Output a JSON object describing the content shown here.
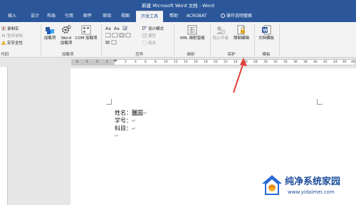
{
  "window": {
    "title": "新建 Microsoft Word 文档 - Word"
  },
  "tabs": [
    {
      "label": "插入"
    },
    {
      "label": "设计"
    },
    {
      "label": "布局"
    },
    {
      "label": "引用"
    },
    {
      "label": "邮件"
    },
    {
      "label": "审阅"
    },
    {
      "label": "视图"
    },
    {
      "label": "开发工具",
      "active": true
    },
    {
      "label": "帮助"
    },
    {
      "label": "ACROBAT"
    },
    {
      "label": "操作说明搜索"
    }
  ],
  "ribbon": {
    "code": {
      "record_macro": "录制宏",
      "pause_recording": "暂停录制",
      "macro_security": "宏安全性",
      "group_label": "代码"
    },
    "addins": {
      "addins": "加载项",
      "word_addins_line1": "Word",
      "word_addins_line2": "加载项",
      "com_addins": "COM 加载项",
      "group_label": "加载项"
    },
    "controls": {
      "design_mode": "设计模式",
      "properties": "属性",
      "group": "组合",
      "group_label": "控件"
    },
    "mapping": {
      "xml_pane": "XML 映射窗格",
      "group_label": "映射"
    },
    "protect": {
      "block_authors": "阻止作者",
      "restrict_editing": "限制编辑",
      "group_label": "保护"
    },
    "templates": {
      "document_template": "文档模板",
      "group_label": "模板"
    }
  },
  "ruler": {
    "numbers": [
      "8",
      "6",
      "4",
      "2",
      "2",
      "4",
      "6",
      "8",
      "10",
      "12",
      "14",
      "16",
      "18",
      "20",
      "22",
      "24",
      "26",
      "28",
      "30",
      "32",
      "34",
      "36",
      "38",
      "40",
      "42",
      "44",
      "46",
      "48"
    ]
  },
  "document": {
    "line1_label": "姓名：",
    "line1_value": "张三",
    "line2_label": "学号：",
    "line3_label": "科目：",
    "pilcrow": "↵"
  },
  "watermark": {
    "title": "纯净系统家园",
    "url": "www.yidaimei.com"
  },
  "colors": {
    "accent": "#2b579a",
    "annotation_arrow": "#e0403a"
  }
}
